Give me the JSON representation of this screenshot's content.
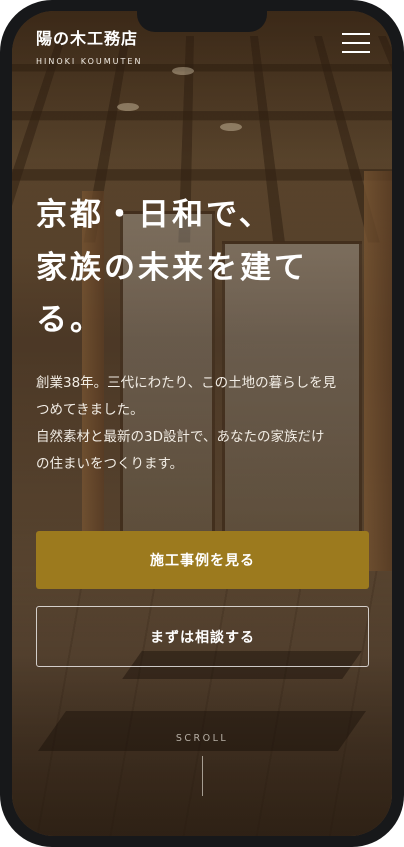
{
  "header": {
    "logo": "陽の木工務店",
    "logo_sub": "HINOKI KOUMUTEN",
    "menu_icon": "hamburger-menu-icon"
  },
  "hero": {
    "title_lines": [
      "京都・日和で、",
      "家族の未来を建て",
      "る。"
    ],
    "lead_lines": [
      "創業38年。三代にわたり、この土地の暮らしを見",
      "つめてきました。",
      "自然素材と最新の3D設計で、あなたの家族だけ",
      "の住まいをつくります。"
    ]
  },
  "buttons": {
    "primary_label": "施工事例を見る",
    "secondary_label": "まずは相談する",
    "primary_color": "#9c7a1e"
  },
  "scroll": {
    "label": "SCROLL"
  }
}
